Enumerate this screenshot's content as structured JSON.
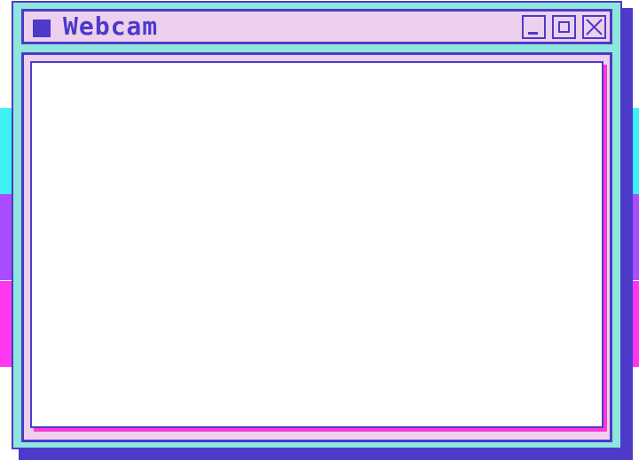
{
  "window": {
    "title": "Webcam"
  },
  "controls": {
    "minimize_icon": "minimize-icon",
    "maximize_icon": "maximize-icon",
    "close_icon": "close-icon"
  },
  "colors": {
    "frame_border": "#4d3ac8",
    "window_fill": "#8ee6dc",
    "titlebar_fill": "#ecd0ee",
    "shadow": "#4d3ac8",
    "viewport_shadow": "#ff38d6",
    "stripe_cyan": "#3ef0f5",
    "stripe_purple": "#a84dff",
    "stripe_pink": "#ff38f0"
  }
}
